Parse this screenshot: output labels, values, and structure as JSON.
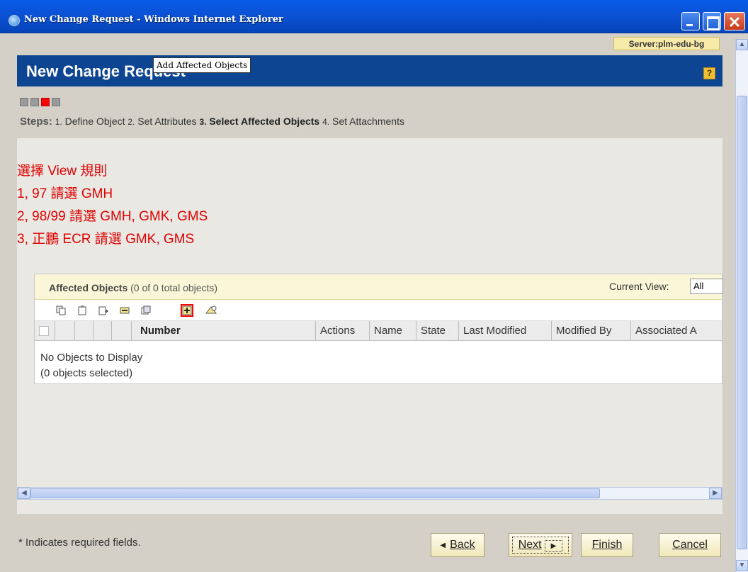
{
  "window": {
    "title": "New Change Request - Windows Internet Explorer"
  },
  "server_label": "Server:plm-edu-bg",
  "header": {
    "title": "New Change Request",
    "help": "?"
  },
  "steps": {
    "label": "Steps:",
    "items": [
      {
        "num": "1.",
        "label": "Define Object"
      },
      {
        "num": "2.",
        "label": "Set Attributes"
      },
      {
        "num": "3.",
        "label": "Select Affected Objects"
      },
      {
        "num": "4.",
        "label": "Set Attachments"
      }
    ]
  },
  "notes": [
    "選擇 View 規則",
    "1, 97 請選 GMH",
    "2, 98/99 請選 GMH, GMK, GMS",
    "3, 正鵬 ECR 請選 GMK, GMS"
  ],
  "affected_objects": {
    "title": "Affected Objects",
    "count": "(0 of 0 total objects)",
    "current_view_label": "Current View:",
    "current_view_value": "All",
    "columns": [
      "Number",
      "Actions",
      "Name",
      "State",
      "Last Modified",
      "Modified By",
      "Associated A"
    ],
    "tooltip": "Add Affected Objects",
    "empty_text": "No Objects to Display",
    "selected_text": "(0 objects selected)"
  },
  "footer": {
    "required_note": "Indicates required fields.",
    "back": "Back",
    "next": "Next",
    "finish": "Finish",
    "cancel": "Cancel"
  }
}
